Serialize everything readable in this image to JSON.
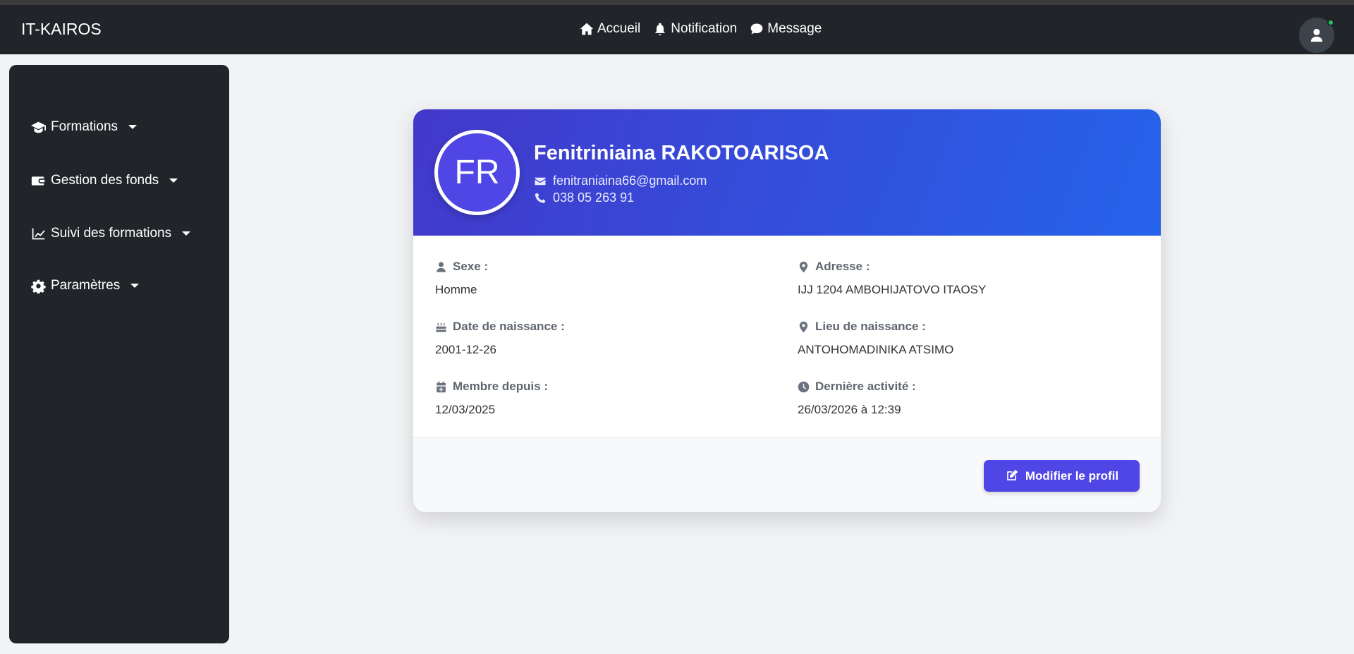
{
  "navbar": {
    "brand": "IT-KAIROS",
    "links": [
      {
        "label": "Accueil",
        "icon": "home-icon"
      },
      {
        "label": "Notification",
        "icon": "bell-icon"
      },
      {
        "label": "Message",
        "icon": "comment-icon"
      }
    ]
  },
  "sidebar": {
    "items": [
      {
        "label": "Formations",
        "icon": "graduation-cap-icon"
      },
      {
        "label": "Gestion des fonds",
        "icon": "wallet-icon"
      },
      {
        "label": "Suivi des formations",
        "icon": "chart-line-icon"
      },
      {
        "label": "Paramètres",
        "icon": "gear-icon"
      }
    ]
  },
  "profile": {
    "initials": "FR",
    "name": "Fenitriniaina RAKOTOARISOA",
    "email": "fenitraniaina66@gmail.com",
    "phone": "038 05 263 91",
    "fields": [
      {
        "label": "Sexe :",
        "value": "Homme"
      },
      {
        "label": "Adresse :",
        "value": "IJJ 1204 AMBOHIJATOVO ITAOSY"
      },
      {
        "label": "Date de naissance :",
        "value": "2001-12-26"
      },
      {
        "label": "Lieu de naissance :",
        "value": "ANTOHOMADINIKA ATSIMO"
      },
      {
        "label": "Membre depuis :",
        "value": "12/03/2025"
      },
      {
        "label": "Dernière activité :",
        "value": "26/03/2026 à 12:39"
      }
    ],
    "edit_label": "Modifier le profil"
  },
  "colors": {
    "navbar": "#212529",
    "accent": "#4f46e5",
    "gradient_end": "#2563eb"
  }
}
